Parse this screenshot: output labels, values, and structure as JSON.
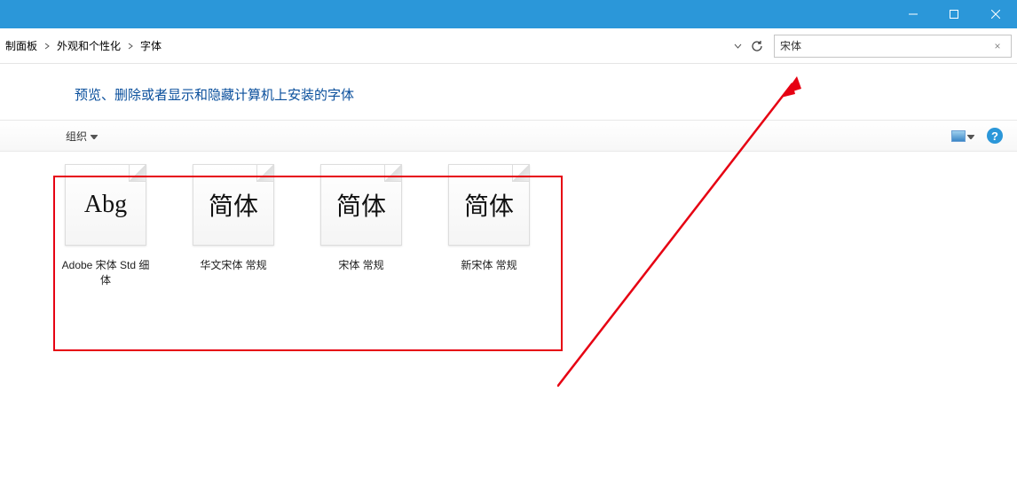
{
  "titlebar": {
    "minimize": "minimize",
    "maximize": "maximize",
    "close": "close"
  },
  "breadcrumb": {
    "items": [
      "制面板",
      "外观和个性化",
      "字体"
    ]
  },
  "search": {
    "value": "宋体",
    "clear_label": "×"
  },
  "heading": "预览、删除或者显示和隐藏计算机上安装的字体",
  "toolbar": {
    "organize_label": "组织",
    "help_label": "?"
  },
  "fonts": [
    {
      "preview": "Abg",
      "label": "Adobe 宋体 Std 细体"
    },
    {
      "preview": "简体",
      "label": "华文宋体 常规"
    },
    {
      "preview": "简体",
      "label": "宋体 常规"
    },
    {
      "preview": "简体",
      "label": "新宋体 常规"
    }
  ]
}
